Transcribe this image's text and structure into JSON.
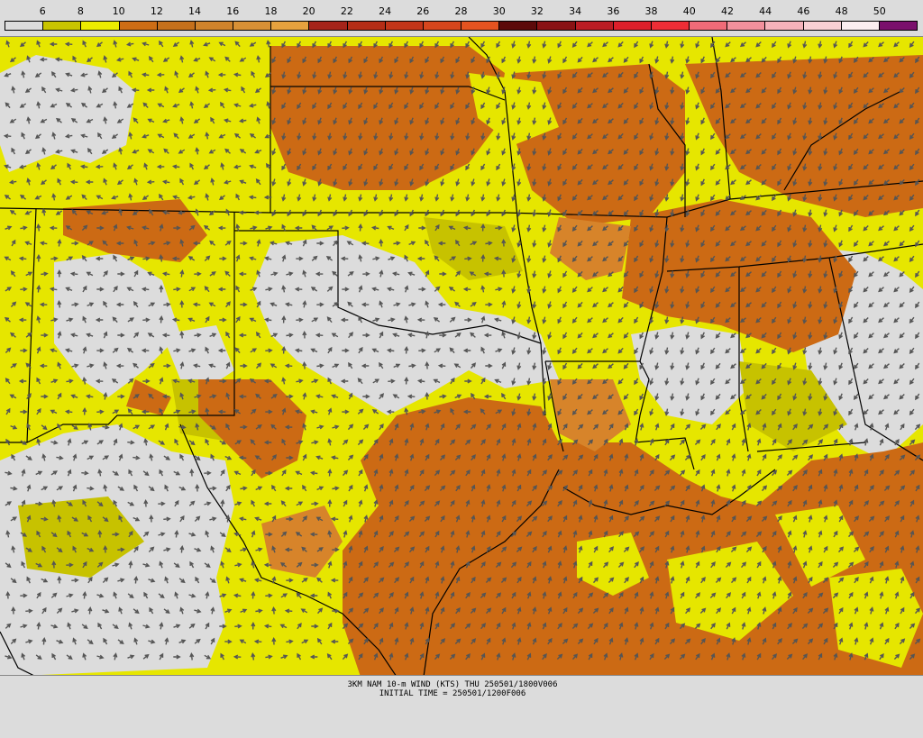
{
  "legend": {
    "ticks": [
      "6",
      "8",
      "10",
      "12",
      "14",
      "16",
      "18",
      "20",
      "22",
      "24",
      "26",
      "28",
      "30",
      "32",
      "34",
      "36",
      "38",
      "40",
      "42",
      "44",
      "46",
      "48",
      "50"
    ],
    "colors": [
      "#dcdcdc",
      "#c9c400",
      "#ecec00",
      "#cd6d15",
      "#c5701b",
      "#d0832b",
      "#d89035",
      "#e6a23e",
      "#a5241a",
      "#b52d16",
      "#c23519",
      "#d6461d",
      "#e55320",
      "#5c0a0a",
      "#8a1214",
      "#bb1d24",
      "#dd1f2a",
      "#ee2d36",
      "#f06b78",
      "#f2909c",
      "#f5b2ba",
      "#f8d0d4",
      "#fbeef0",
      "#7a0f6c"
    ]
  },
  "map": {
    "field_colors": {
      "calm": "#dcdcdc",
      "light": "#e6e600",
      "light_dark": "#c7c200",
      "moderate": "#cc6a14",
      "moderate_light": "#d7842a",
      "strong": "#bf5a12"
    },
    "arrow_color": "#555555",
    "border_color": "#000000"
  },
  "caption": {
    "line1": "3KM NAM 10-m WIND (KTS) THU 250501/1800V006",
    "line2": "INITIAL TIME = 250501/1200F006"
  }
}
